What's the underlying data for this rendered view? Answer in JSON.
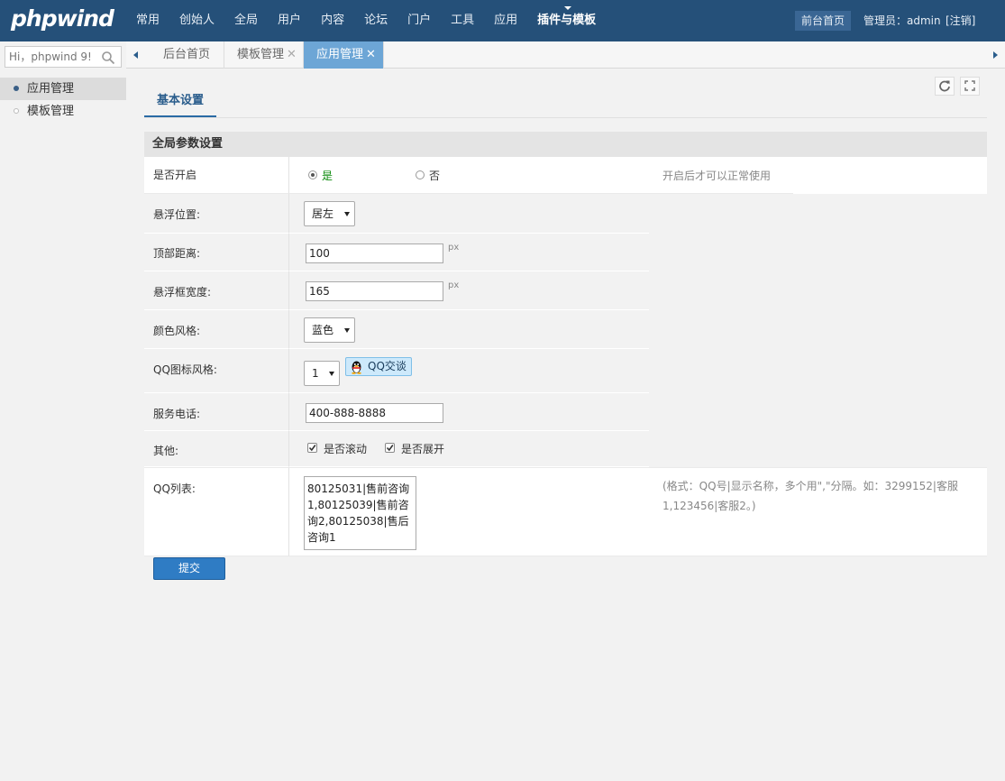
{
  "header": {
    "logo": "phpwind",
    "nav": [
      {
        "label": "常用"
      },
      {
        "label": "创始人"
      },
      {
        "label": "全局"
      },
      {
        "label": "用户"
      },
      {
        "label": "内容"
      },
      {
        "label": "论坛"
      },
      {
        "label": "门户"
      },
      {
        "label": "工具"
      },
      {
        "label": "应用"
      },
      {
        "label": "插件与模板",
        "active": true
      }
    ],
    "front_link": "前台首页",
    "admin_label": "管理员：admin",
    "logout": "[注销]"
  },
  "search": {
    "placeholder": "Hi，phpwind 9!"
  },
  "tabs": [
    {
      "label": "后台首页",
      "closable": false,
      "active": false
    },
    {
      "label": "模板管理",
      "closable": true,
      "active": false
    },
    {
      "label": "应用管理",
      "closable": true,
      "active": true
    }
  ],
  "sidebar": {
    "items": [
      {
        "label": "应用管理",
        "active": true
      },
      {
        "label": "模板管理",
        "active": false
      }
    ]
  },
  "main": {
    "subtab": "基本设置",
    "section_title": "全局参数设置",
    "rows": {
      "enable": {
        "label": "是否开启",
        "yes": "是",
        "no": "否",
        "selected": "是",
        "tip": "开启后才可以正常使用"
      },
      "float_position": {
        "label": "悬浮位置:",
        "value": "居左"
      },
      "top_distance": {
        "label": "顶部距离:",
        "value": "100",
        "unit": "px"
      },
      "float_width": {
        "label": "悬浮框宽度:",
        "value": "165",
        "unit": "px"
      },
      "color_style": {
        "label": "颜色风格:",
        "value": "蓝色"
      },
      "qq_icon_style": {
        "label": "QQ图标风格:",
        "value": "1",
        "preview": "QQ交谈"
      },
      "service_phone": {
        "label": "服务电话:",
        "value": "400-888-8888"
      },
      "other": {
        "label": "其他:",
        "scroll_label": "是否滚动",
        "scroll_checked": true,
        "expand_label": "是否展开",
        "expand_checked": true
      },
      "qq_list": {
        "label": "QQ列表:",
        "value": "80125031|售前咨询1,80125039|售前咨询2,80125038|售后咨询1",
        "tip": "(格式：QQ号|显示名称，多个用\",\"分隔。如：3299152|客服1,123456|客服2。)"
      }
    },
    "submit": "提交"
  },
  "colors": {
    "header_bg": "#255079",
    "tab_active_bg": "#6da6d6",
    "submit_bg": "#2f7cc4",
    "radio_selected_text": "#0a8a0a"
  }
}
